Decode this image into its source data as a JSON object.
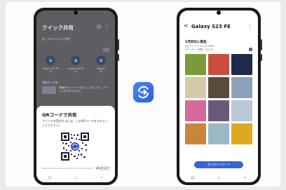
{
  "left_phone": {
    "header_title": "クイック共有",
    "header_icons": [
      "history-icon",
      "more-icon"
    ],
    "subtitle": "近くのデバイスと共有",
    "devices": [
      {
        "name": "Galaxy S23 FE",
        "detail": "(1)"
      },
      {
        "name": "Galaxy S23 FE",
        "detail": "(2)"
      },
      {
        "name": "Galaxy",
        "detail": "(3)"
      }
    ],
    "section_label": "連絡先と共有",
    "info_text": "連絡先のメンバーが近くにいなくても、ファイルを共有できます。",
    "sheet": {
      "title": "QRコードで共有",
      "description": "ファイルを受信するには、このQRコードをスキャンしてください。",
      "url": "https://quickshare.samsungcloud.com/share/abcdef123",
      "copy_label": "URLをコピー"
    },
    "nav": [
      "|||",
      "○",
      "<"
    ]
  },
  "share_icon": "quick-share-icon",
  "right_phone": {
    "back_label": "<",
    "title": "Galaxy S23 FE",
    "more_label": "⋮",
    "date": "1月8日に受信",
    "meta_line1": "合計ファイル: 12 (45.8 MB)",
    "meta_line2": "ダウンロード期限: 1月10日",
    "photos": [
      {
        "color": "#7b9a3a"
      },
      {
        "color": "#c94f3a"
      },
      {
        "color": "#1f2a4a"
      },
      {
        "color": "#d7c8a8"
      },
      {
        "color": "#5a4a3a"
      },
      {
        "color": "#8aa3b8"
      },
      {
        "color": "#d56a9a"
      },
      {
        "color": "#6a5a7a"
      },
      {
        "color": "#b8c8d8"
      },
      {
        "color": "#c8863a"
      },
      {
        "color": "#9ab8c8"
      },
      {
        "color": "#e0a820"
      }
    ],
    "download_label": "全てダウンロード",
    "nav": [
      "|||",
      "○",
      "<"
    ]
  },
  "colors": {
    "background": "#ebebee",
    "accent_blue": "#3a62d8"
  }
}
